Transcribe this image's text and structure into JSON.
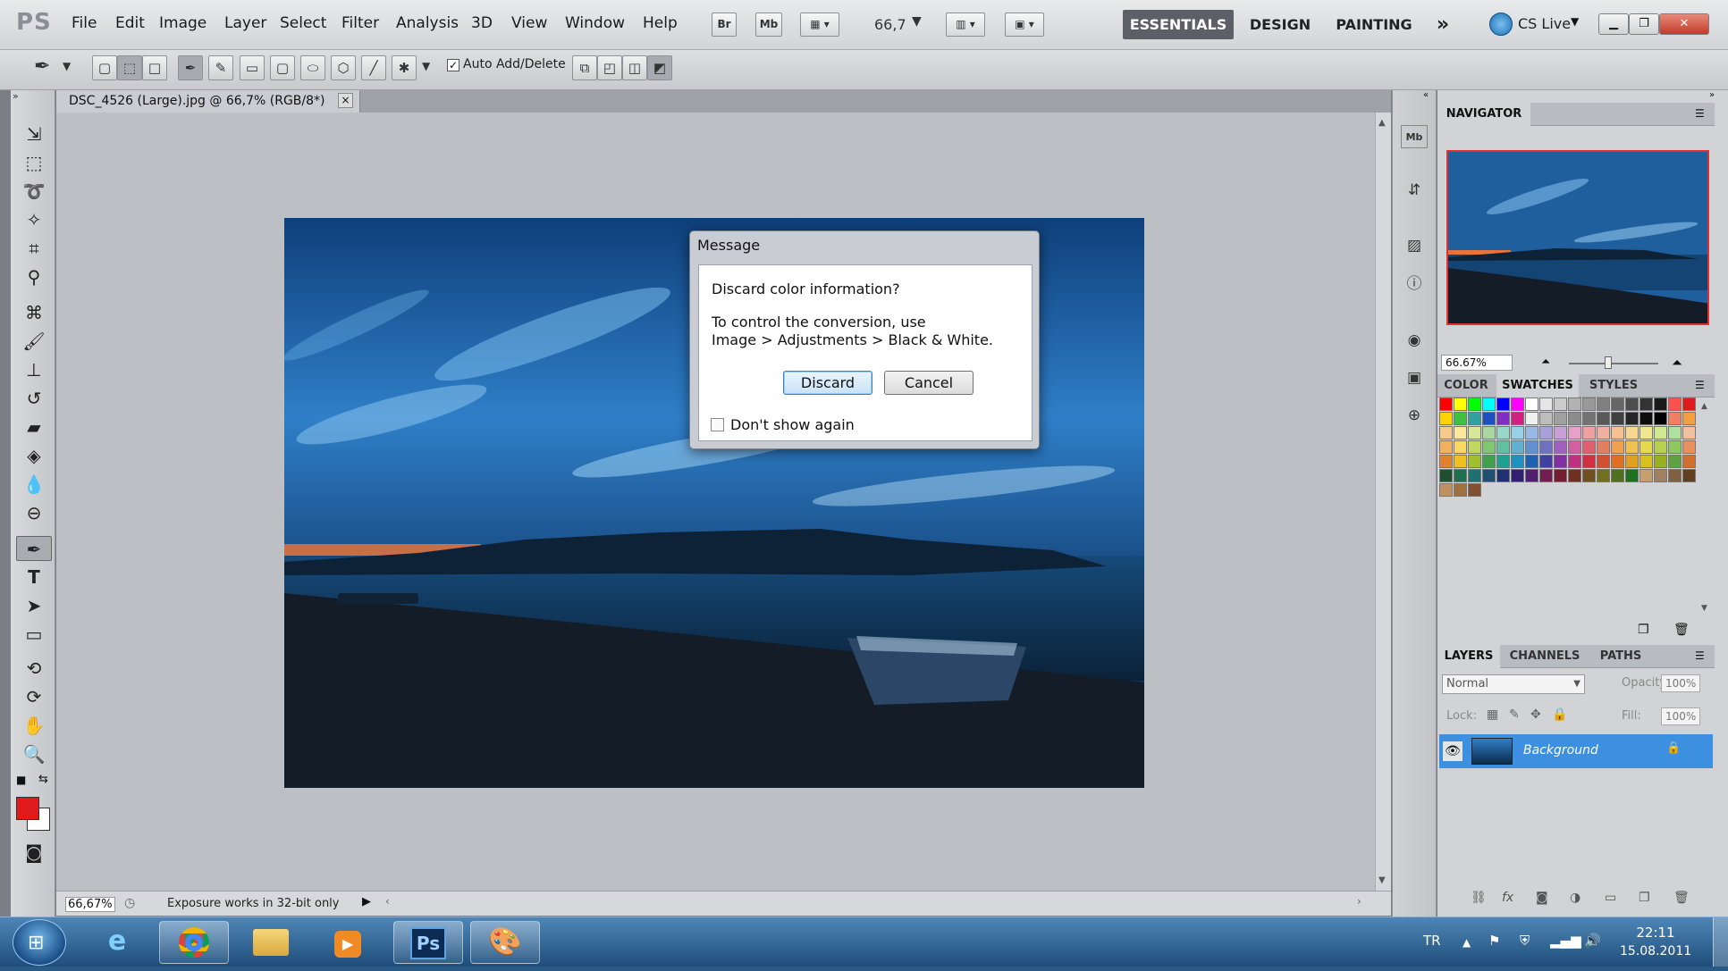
{
  "app": {
    "logo": "PS"
  },
  "menu": [
    "File",
    "Edit",
    "Image",
    "Layer",
    "Select",
    "Filter",
    "Analysis",
    "3D",
    "View",
    "Window",
    "Help"
  ],
  "menubar_buttons": {
    "bridge": "Br",
    "mini_bridge": "Mb",
    "zoom": "66,7"
  },
  "workspaces": {
    "essentials": "ESSENTIALS",
    "design": "DESIGN",
    "painting": "PAINTING",
    "more": "»",
    "cs_live": "CS Live"
  },
  "options": {
    "auto_add_delete": "Auto Add/Delete"
  },
  "document": {
    "tab_title": "DSC_4526 (Large).jpg @ 66,7% (RGB/8*)",
    "close": "×"
  },
  "status": {
    "zoom": "66,67%",
    "info": "Exposure works in 32-bit only"
  },
  "navigator": {
    "title": "NAVIGATOR",
    "zoom": "66.67%"
  },
  "color_panel": {
    "tabs": [
      "COLOR",
      "SWATCHES",
      "STYLES"
    ],
    "active": "SWATCHES"
  },
  "layers_panel": {
    "tabs": [
      "LAYERS",
      "CHANNELS",
      "PATHS"
    ],
    "blend_mode": "Normal",
    "opacity_label": "Opacity:",
    "opacity": "100%",
    "lock_label": "Lock:",
    "fill_label": "Fill:",
    "fill": "100%",
    "layer_name": "Background"
  },
  "dialog": {
    "title": "Message",
    "question": "Discard color information?",
    "line1": "To control the conversion, use",
    "line2": "Image > Adjustments > Black & White.",
    "discard": "Discard",
    "cancel": "Cancel",
    "dont_show": "Don't show again"
  },
  "taskbar": {
    "lang": "TR",
    "time": "22:11",
    "date": "15.08.2011"
  },
  "colors": {
    "foreground": "#e01a1a",
    "background": "#ffffff",
    "selected_layer": "#3d8fe0"
  }
}
